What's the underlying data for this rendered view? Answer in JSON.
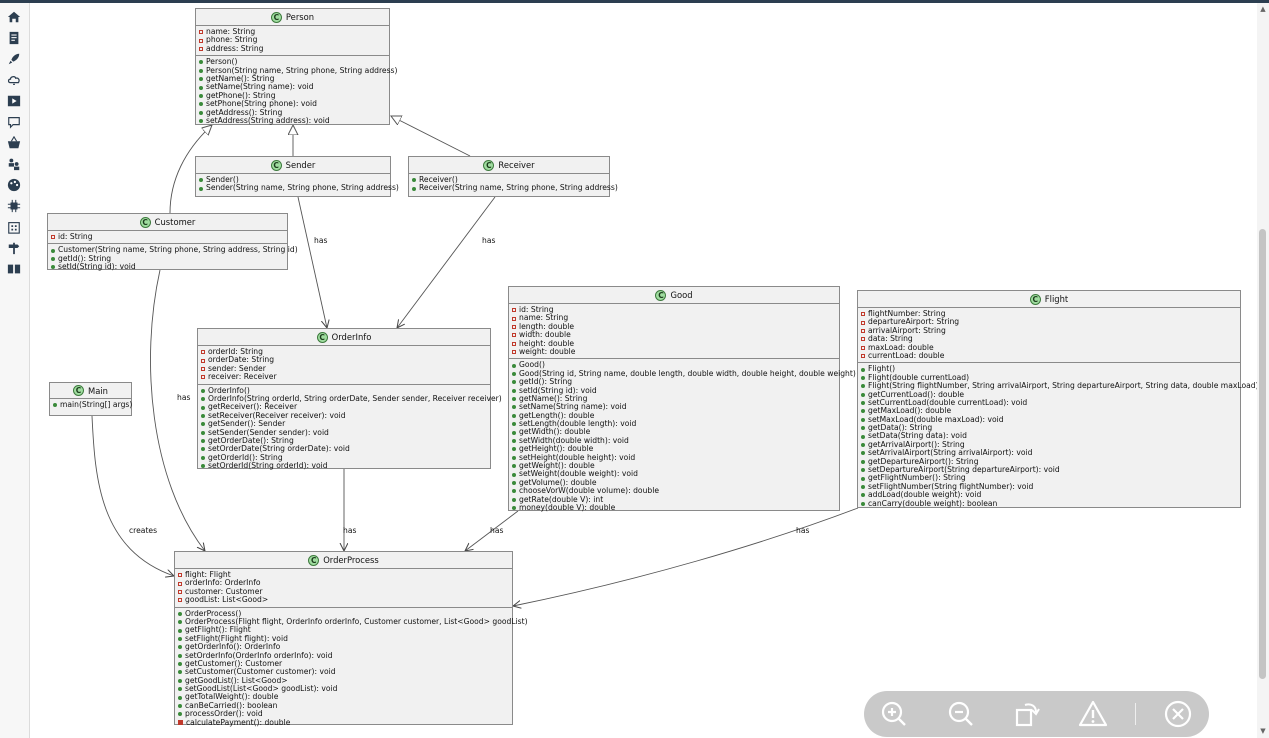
{
  "sidebar": {
    "icons": [
      "home-icon",
      "document-icon",
      "rocket-icon",
      "cloud-icon",
      "play-icon",
      "chat-icon",
      "basket-icon",
      "people-icon",
      "palette-icon",
      "chip-icon",
      "building-icon",
      "signpost-icon",
      "book-icon"
    ]
  },
  "diagram": {
    "classes": {
      "person": {
        "name": "Person",
        "fields": [
          "name: String",
          "phone: String",
          "address: String"
        ],
        "methods": [
          "Person()",
          "Person(String name, String phone, String address)",
          "getName(): String",
          "setName(String name): void",
          "getPhone(): String",
          "setPhone(String phone): void",
          "getAddress(): String",
          "setAddress(String address): void"
        ]
      },
      "sender": {
        "name": "Sender",
        "methods": [
          "Sender()",
          "Sender(String name, String phone, String address)"
        ]
      },
      "receiver": {
        "name": "Receiver",
        "methods": [
          "Receiver()",
          "Receiver(String name, String phone, String address)"
        ]
      },
      "customer": {
        "name": "Customer",
        "fields": [
          "id: String"
        ],
        "methods": [
          "Customer(String name, String phone, String address, String id)",
          "getId(): String",
          "setId(String id): void"
        ]
      },
      "main": {
        "name": "Main",
        "methods": [
          "main(String[] args)"
        ]
      },
      "orderinfo": {
        "name": "OrderInfo",
        "fields": [
          "orderId: String",
          "orderDate: String",
          "sender: Sender",
          "receiver: Receiver"
        ],
        "methods": [
          "OrderInfo()",
          "OrderInfo(String orderId, String orderDate, Sender sender, Receiver receiver)",
          "getReceiver(): Receiver",
          "setReceiver(Receiver receiver): void",
          "getSender(): Sender",
          "setSender(Sender sender): void",
          "getOrderDate(): String",
          "setOrderDate(String orderDate): void",
          "getOrderId(): String",
          "setOrderId(String orderId): void"
        ]
      },
      "good": {
        "name": "Good",
        "fields": [
          "id: String",
          "name: String",
          "length: double",
          "width: double",
          "height: double",
          "weight: double"
        ],
        "methods": [
          "Good()",
          "Good(String id, String name, double length, double width, double height, double weight)",
          "getId(): String",
          "setId(String id): void",
          "getName(): String",
          "setName(String name): void",
          "getLength(): double",
          "setLength(double length): void",
          "getWidth(): double",
          "setWidth(double width): void",
          "getHeight(): double",
          "setHeight(double height): void",
          "getWeight(): double",
          "setWeight(double weight): void",
          "getVolume(): double",
          "chooseVorW(double volume): double",
          "getRate(double V): int",
          "money(double V): double"
        ]
      },
      "flight": {
        "name": "Flight",
        "fields": [
          "flightNumber: String",
          "departureAirport: String",
          "arrivalAirport: String",
          "data: String",
          "maxLoad: double",
          "currentLoad: double"
        ],
        "methods": [
          "Flight()",
          "Flight(double currentLoad)",
          "Flight(String flightNumber, String arrivalAirport, String departureAirport, String data, double maxLoad)",
          "getCurrentLoad(): double",
          "setCurrentLoad(double currentLoad): void",
          "getMaxLoad(): double",
          "setMaxLoad(double maxLoad): void",
          "getData(): String",
          "setData(String data): void",
          "getArrivalAirport(): String",
          "setArrivalAirport(String arrivalAirport): void",
          "getDepartureAirport(): String",
          "setDepartureAirport(String departureAirport): void",
          "getFlightNumber(): String",
          "setFlightNumber(String flightNumber): void",
          "addLoad(double weight): void",
          "canCarry(double weight): boolean"
        ]
      },
      "orderprocess": {
        "name": "OrderProcess",
        "fields": [
          "flight: Flight",
          "orderInfo: OrderInfo",
          "customer: Customer",
          "goodList: List<Good>"
        ],
        "methods": [
          "OrderProcess()",
          "OrderProcess(Flight flight, OrderInfo orderInfo, Customer customer, List<Good> goodList)",
          "getFlight(): Flight",
          "setFlight(Flight flight): void",
          "getOrderInfo(): OrderInfo",
          "setOrderInfo(OrderInfo orderInfo): void",
          "getCustomer(): Customer",
          "setCustomer(Customer customer): void",
          "getGoodList(): List<Good>",
          "setGoodList(List<Good> goodList): void",
          "getTotalWeight(): double",
          "canBeCarried(): boolean",
          "processOrder(): void"
        ],
        "private_methods": [
          "calculatePayment(): double"
        ]
      }
    },
    "class_badge": "C",
    "edge_labels": {
      "has": "has",
      "creates": "creates"
    }
  },
  "colors": {
    "class_fill": "#f1f1f1",
    "class_border": "#8a8a8a",
    "badge_fill": "#9fdc9f",
    "private_marker": "#c0392b",
    "public_marker": "#3a8a3a",
    "toolbar_bg": "#c9c9c9"
  },
  "toolbar": {
    "buttons": [
      "zoom-in-icon",
      "zoom-out-icon",
      "rotate-icon",
      "warning-icon",
      "close-icon"
    ]
  }
}
